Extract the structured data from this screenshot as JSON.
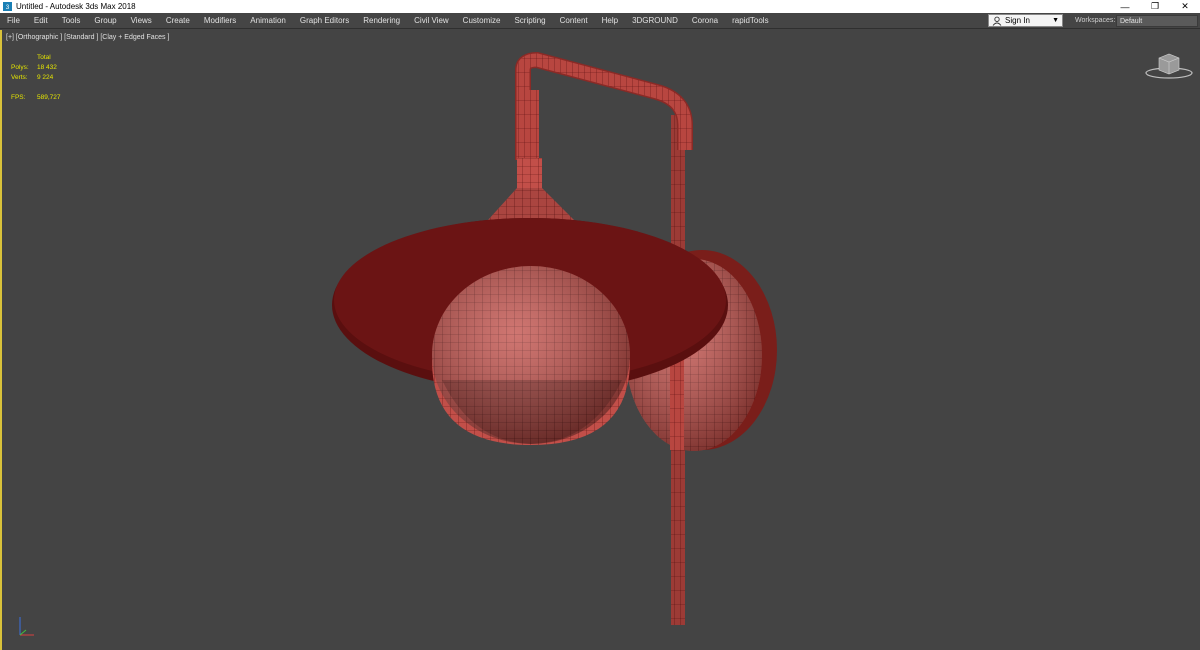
{
  "window": {
    "title": "Untitled - Autodesk 3ds Max 2018",
    "controls": {
      "minimize": "—",
      "restore": "❐",
      "close": "✕"
    }
  },
  "menu": {
    "items": [
      "File",
      "Edit",
      "Tools",
      "Group",
      "Views",
      "Create",
      "Modifiers",
      "Animation",
      "Graph Editors",
      "Rendering",
      "Civil View",
      "Customize",
      "Scripting",
      "Content",
      "Help",
      "3DGROUND",
      "Corona",
      "rapidTools"
    ],
    "sign_in": "Sign In",
    "workspaces_label": "Workspaces:",
    "workspace_value": "Default"
  },
  "viewport": {
    "label": "[+] [Orthographic ] [Standard ] [Clay + Edged Faces ]",
    "stats": {
      "header": "Total",
      "polys_label": "Polys:",
      "polys_value": "18 432",
      "verts_label": "Verts:",
      "verts_value": "9 224",
      "fps_label": "FPS:",
      "fps_value": "589,727"
    }
  },
  "colors": {
    "viewport_bg": "#444444",
    "model": "#c0504a",
    "model_dark": "#6e1414",
    "stats_text": "#e6e600",
    "active_border": "#d9c23a"
  },
  "icons": {
    "app": "3dsmax-app-icon",
    "user": "user-icon",
    "viewcube": "viewcube-icon",
    "axis": "axis-tripod-icon"
  }
}
